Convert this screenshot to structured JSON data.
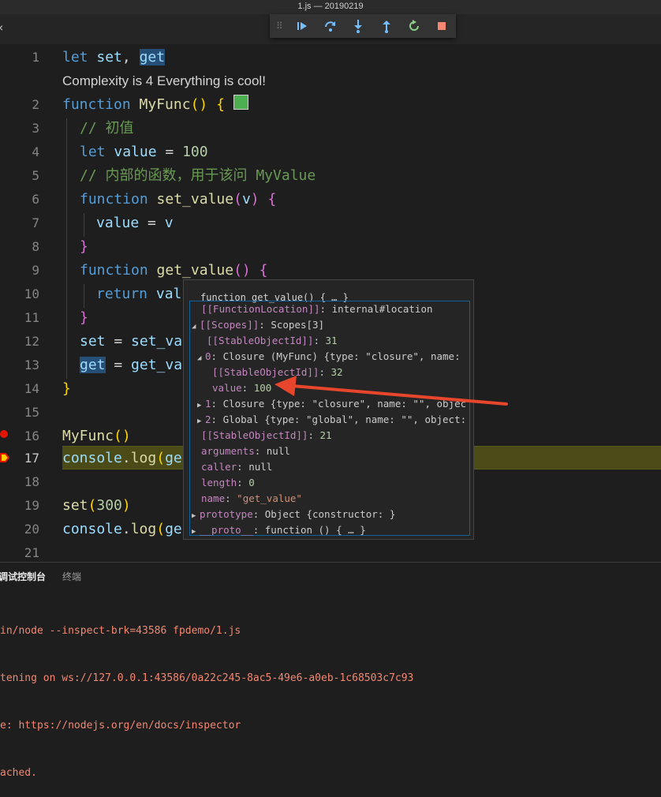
{
  "window": {
    "title": "1.js — 20190219"
  },
  "debug_toolbar": {
    "buttons": [
      {
        "name": "continue",
        "icon": "continue-icon"
      },
      {
        "name": "step-over",
        "icon": "step-over-icon"
      },
      {
        "name": "step-into",
        "icon": "step-into-icon"
      },
      {
        "name": "step-out",
        "icon": "step-out-icon"
      },
      {
        "name": "restart",
        "icon": "restart-icon"
      },
      {
        "name": "stop",
        "icon": "stop-icon"
      }
    ]
  },
  "editor": {
    "codelens": "Complexity is 4 Everything is cool!",
    "line_numbers": [
      "1",
      "2",
      "3",
      "4",
      "5",
      "6",
      "7",
      "8",
      "9",
      "10",
      "11",
      "12",
      "13",
      "14",
      "15",
      "16",
      "17",
      "18",
      "19",
      "20",
      "21"
    ],
    "lines": {
      "l1": {
        "kw": "let",
        "a": "set",
        "sep": ", ",
        "b": "get"
      },
      "l2": {
        "kw": "function",
        "name": "MyFunc",
        "paren": "()",
        "brace": "{"
      },
      "l3": "// 初值",
      "l4": {
        "kw": "let",
        "name": "value",
        "eq": " = ",
        "num": "100"
      },
      "l5": "// 内部的函数，用于该问 MyValue",
      "l6": {
        "kw": "function",
        "name": "set_value",
        "p1": "(",
        "arg": "v",
        "p2": ")",
        "brace": "{"
      },
      "l7": {
        "a": "value",
        "eq": " = ",
        "b": "v"
      },
      "l8": "}",
      "l9": {
        "kw": "function",
        "name": "get_value",
        "paren": "()",
        "brace": "{"
      },
      "l10": {
        "kw": "return",
        "rest": "val"
      },
      "l11": "}",
      "l12": {
        "a": "set",
        "eq": " = ",
        "rest": "set_va"
      },
      "l13": {
        "a": "get",
        "eq": " = ",
        "rest": "get_va"
      },
      "l14": "}",
      "l16": {
        "name": "MyFunc",
        "paren": "()"
      },
      "l17": {
        "obj": "console",
        "dot": ".",
        "m": "log",
        "p": "(",
        "rest": "ge"
      },
      "l19": {
        "name": "set",
        "p1": "(",
        "num": "300",
        "p2": ")"
      },
      "l20": {
        "obj": "console",
        "dot": ".",
        "m": "log",
        "p": "(",
        "rest": "ge"
      }
    }
  },
  "hover": {
    "header": "function get_value() { … }",
    "rows": {
      "r1": {
        "k": "[[FunctionLocation]]",
        "v": ": internal#location"
      },
      "r2": {
        "k": "[[Scopes]]",
        "v": ": Scopes[3]"
      },
      "r3": {
        "k": "[[StableObjectId]]",
        "v": ": ",
        "n": "31"
      },
      "r4": {
        "k": "0",
        "v": ": Closure (MyFunc) {type: \"closure\", name:"
      },
      "r5": {
        "k": "[[StableObjectId]]",
        "v": ": ",
        "n": "32"
      },
      "r6": {
        "k": "value",
        "v": ": ",
        "n": "100"
      },
      "r7": {
        "k": "1",
        "v": ": Closure {type: \"closure\", name: \"\", object"
      },
      "r8": {
        "k": "2",
        "v": ": Global {type: \"global\", name: \"\", object:"
      },
      "r9": {
        "k": "[[StableObjectId]]",
        "v": ": ",
        "n": "21"
      },
      "r10": {
        "k": "arguments",
        "v": ": null"
      },
      "r11": {
        "k": "caller",
        "v": ": null"
      },
      "r12": {
        "k": "length",
        "v": ": ",
        "n": "0"
      },
      "r13": {
        "k": "name",
        "v": ": ",
        "s": "\"get_value\""
      },
      "r14": {
        "k": "prototype",
        "v": ": Object {constructor: }"
      },
      "r15": {
        "k": "__proto__",
        "v": ": function () { … }"
      }
    }
  },
  "panel": {
    "tabs": [
      "调试控制台",
      "终端"
    ],
    "console_lines": [
      "in/node --inspect-brk=43586 fpdemo/1.js",
      "tening on ws://127.0.0.1:43586/0a22c245-8ac5-49e6-a0eb-1c68503c7c93",
      "e: https://nodejs.org/en/docs/inspector",
      "ached."
    ]
  },
  "colors": {
    "accent_current_line": "#4b4b18",
    "breakpoint": "#e51400",
    "arrow": "#e8462c"
  }
}
